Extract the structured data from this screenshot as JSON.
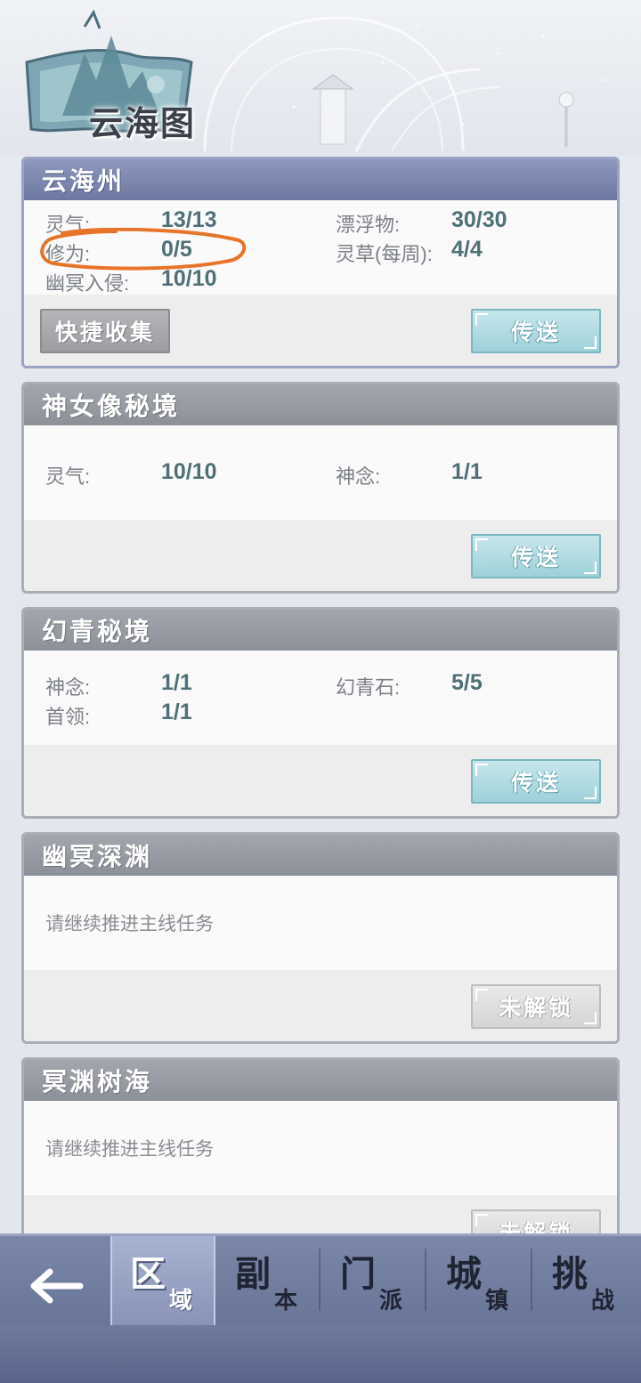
{
  "header": {
    "title": "云海图"
  },
  "cards": [
    {
      "name": "云海州",
      "stats": [
        {
          "label": "灵气:",
          "value": "13/13"
        },
        {
          "label": "漂浮物:",
          "value": "30/30"
        },
        {
          "label": "修为:",
          "value": "0/5"
        },
        {
          "label": "灵草(每周):",
          "value": "4/4"
        },
        {
          "label": "幽冥入侵:",
          "value": "10/10"
        }
      ],
      "quick_collect_label": "快捷收集",
      "action_label": "传送"
    },
    {
      "name": "神女像秘境",
      "stats": [
        {
          "label": "灵气:",
          "value": "10/10"
        },
        {
          "label": "神念:",
          "value": "1/1"
        }
      ],
      "action_label": "传送"
    },
    {
      "name": "幻青秘境",
      "stats": [
        {
          "label": "神念:",
          "value": "1/1"
        },
        {
          "label": "幻青石:",
          "value": "5/5"
        },
        {
          "label": "首领:",
          "value": "1/1"
        }
      ],
      "action_label": "传送"
    },
    {
      "name": "幽冥深渊",
      "hint": "请继续推进主线任务",
      "action_label": "未解锁"
    },
    {
      "name": "冥渊树海",
      "hint": "请继续推进主线任务",
      "action_label": "未解锁"
    }
  ],
  "nav": {
    "back_icon": "arrow-left-icon",
    "tabs": [
      {
        "big": "区",
        "small": "域",
        "active": true
      },
      {
        "big": "副",
        "small": "本",
        "active": false
      },
      {
        "big": "门",
        "small": "派",
        "active": false
      },
      {
        "big": "城",
        "small": "镇",
        "active": false
      },
      {
        "big": "挑",
        "small": "战",
        "active": false
      }
    ]
  },
  "colors": {
    "active_header": "#7a84ac",
    "inactive_header": "#999ca3",
    "teleport_button": "#a9d8df",
    "annotation": "#e8742a",
    "value_text": "#4f7077"
  }
}
